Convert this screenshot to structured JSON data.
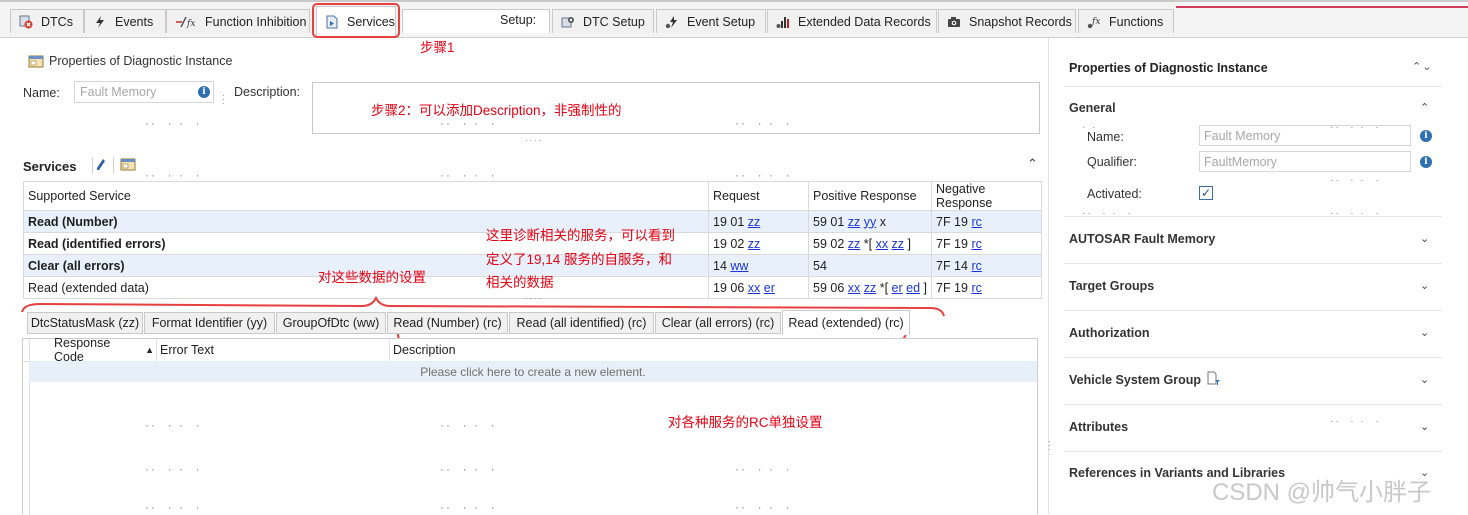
{
  "top_tabs": [
    {
      "label": "DTCs",
      "icon": "dtc-icon"
    },
    {
      "label": "Events",
      "icon": "lightning-icon"
    },
    {
      "label": "Function Inhibition",
      "icon": "function-inhibition-icon"
    },
    {
      "label": "Services",
      "icon": "services-icon"
    },
    {
      "label": "Setup:"
    },
    {
      "label": "DTC Setup",
      "icon": "dtc-setup-icon"
    },
    {
      "label": "Event Setup",
      "icon": "event-setup-icon"
    },
    {
      "label": "Extended Data Records",
      "icon": "bar-chart-icon"
    },
    {
      "label": "Snapshot Records",
      "icon": "camera-icon"
    },
    {
      "label": "Functions",
      "icon": "function-icon"
    }
  ],
  "properties": {
    "title": "Properties of Diagnostic Instance",
    "name_label": "Name:",
    "name_value": "Fault Memory",
    "description_label": "Description:"
  },
  "services": {
    "title": "Services",
    "columns": [
      "Supported Service",
      "Request",
      "Positive Response",
      "Negative Response"
    ],
    "rows": [
      {
        "service": "Read (Number)",
        "request": "19 01 zz",
        "positive": "59 01 zz yy x",
        "negative": "7F 19 rc"
      },
      {
        "service": "Read (identified errors)",
        "request": "19 02 zz",
        "positive": "59 02 zz *[ xx zz ]",
        "negative": "7F 19 rc"
      },
      {
        "service": "Clear (all errors)",
        "request": "14 ww",
        "positive": "54",
        "negative": "7F 14 rc"
      },
      {
        "service": "Read (extended data)",
        "request": "19 06 xx er",
        "positive": "59 06 xx zz *[ er ed ]",
        "negative": "7F 19 rc"
      }
    ]
  },
  "sub_tabs": [
    "DtcStatusMask (zz)",
    "Format Identifier (yy)",
    "GroupOfDtc (ww)",
    "Read (Number) (rc)",
    "Read (all identified) (rc)",
    "Clear (all errors) (rc)",
    "Read (extended) (rc)"
  ],
  "grid": {
    "columns": [
      "Response Code",
      "Error Text",
      "Description"
    ],
    "new_element_text": "Please click here to create a new element."
  },
  "annotations": {
    "step1": "步骤1",
    "step2": "步骤2：可以添加Description，非强制性的",
    "services_note_1": "这里诊断相关的服务，可以看到",
    "services_note_2": "定义了19,14 服务的自服务，和",
    "services_note_3": "相关的数据",
    "data_settings": "对这些数据的设置",
    "rc_settings": "对各种服务的RC单独设置"
  },
  "right_panel": {
    "title": "Properties of Diagnostic Instance",
    "general_title": "General",
    "name_label": "Name:",
    "name_value": "Fault Memory",
    "qualifier_label": "Qualifier:",
    "qualifier_value": "FaultMemory",
    "activated_label": "Activated:",
    "activated": true,
    "sections": [
      "AUTOSAR Fault Memory",
      "Target Groups",
      "Authorization",
      "Vehicle System Group",
      "Attributes",
      "References in Variants and Libraries"
    ]
  },
  "watermark": "CSDN @帅气小胖子",
  "colors": {
    "annotation_red": "#e60012",
    "selected_row": "#e8f1fb",
    "link_blue": "#1a36d8"
  }
}
